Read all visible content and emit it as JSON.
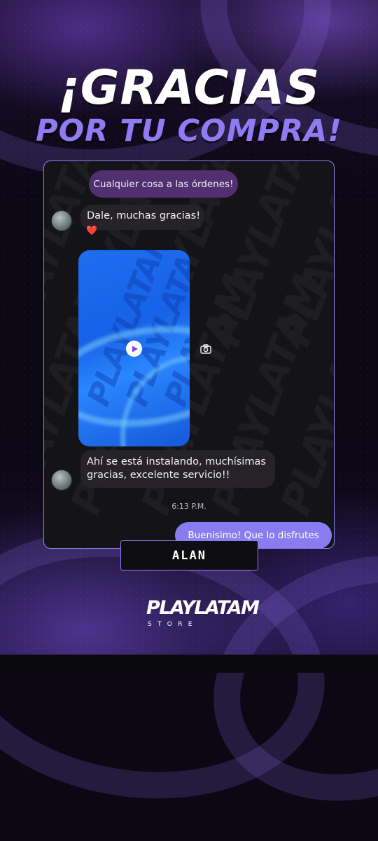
{
  "header": {
    "line1": "¡GRACIAS",
    "line2": "POR TU COMPRA!"
  },
  "chat": {
    "top_message": "Cualquier cosa a las órdenes!",
    "message_1": "Dale, muchas gracias!",
    "reaction": "❤️",
    "media": {
      "type": "video",
      "watermark": "PLAYLATAM",
      "play_icon": "play-icon",
      "action_icon": "camera-icon"
    },
    "message_2_line1": "Ahí se está instalando, muchísimas",
    "message_2_line2": "gracias, excelente servicio!!",
    "timestamp": "6:13 P.M.",
    "reply": "Buenisimo! Que lo disfrutes",
    "watermark": "PLAYLATAM"
  },
  "customer_name": "ALAN",
  "brand": {
    "name": "PLAYLATAM",
    "sub": "STORE"
  },
  "colors": {
    "accent": "#8b83f0",
    "headline_secondary": "#8f7cf2",
    "top_bubble": "#51306f",
    "reply_bubble": "#8a7cf0",
    "media_blue": "#1e6df0"
  }
}
